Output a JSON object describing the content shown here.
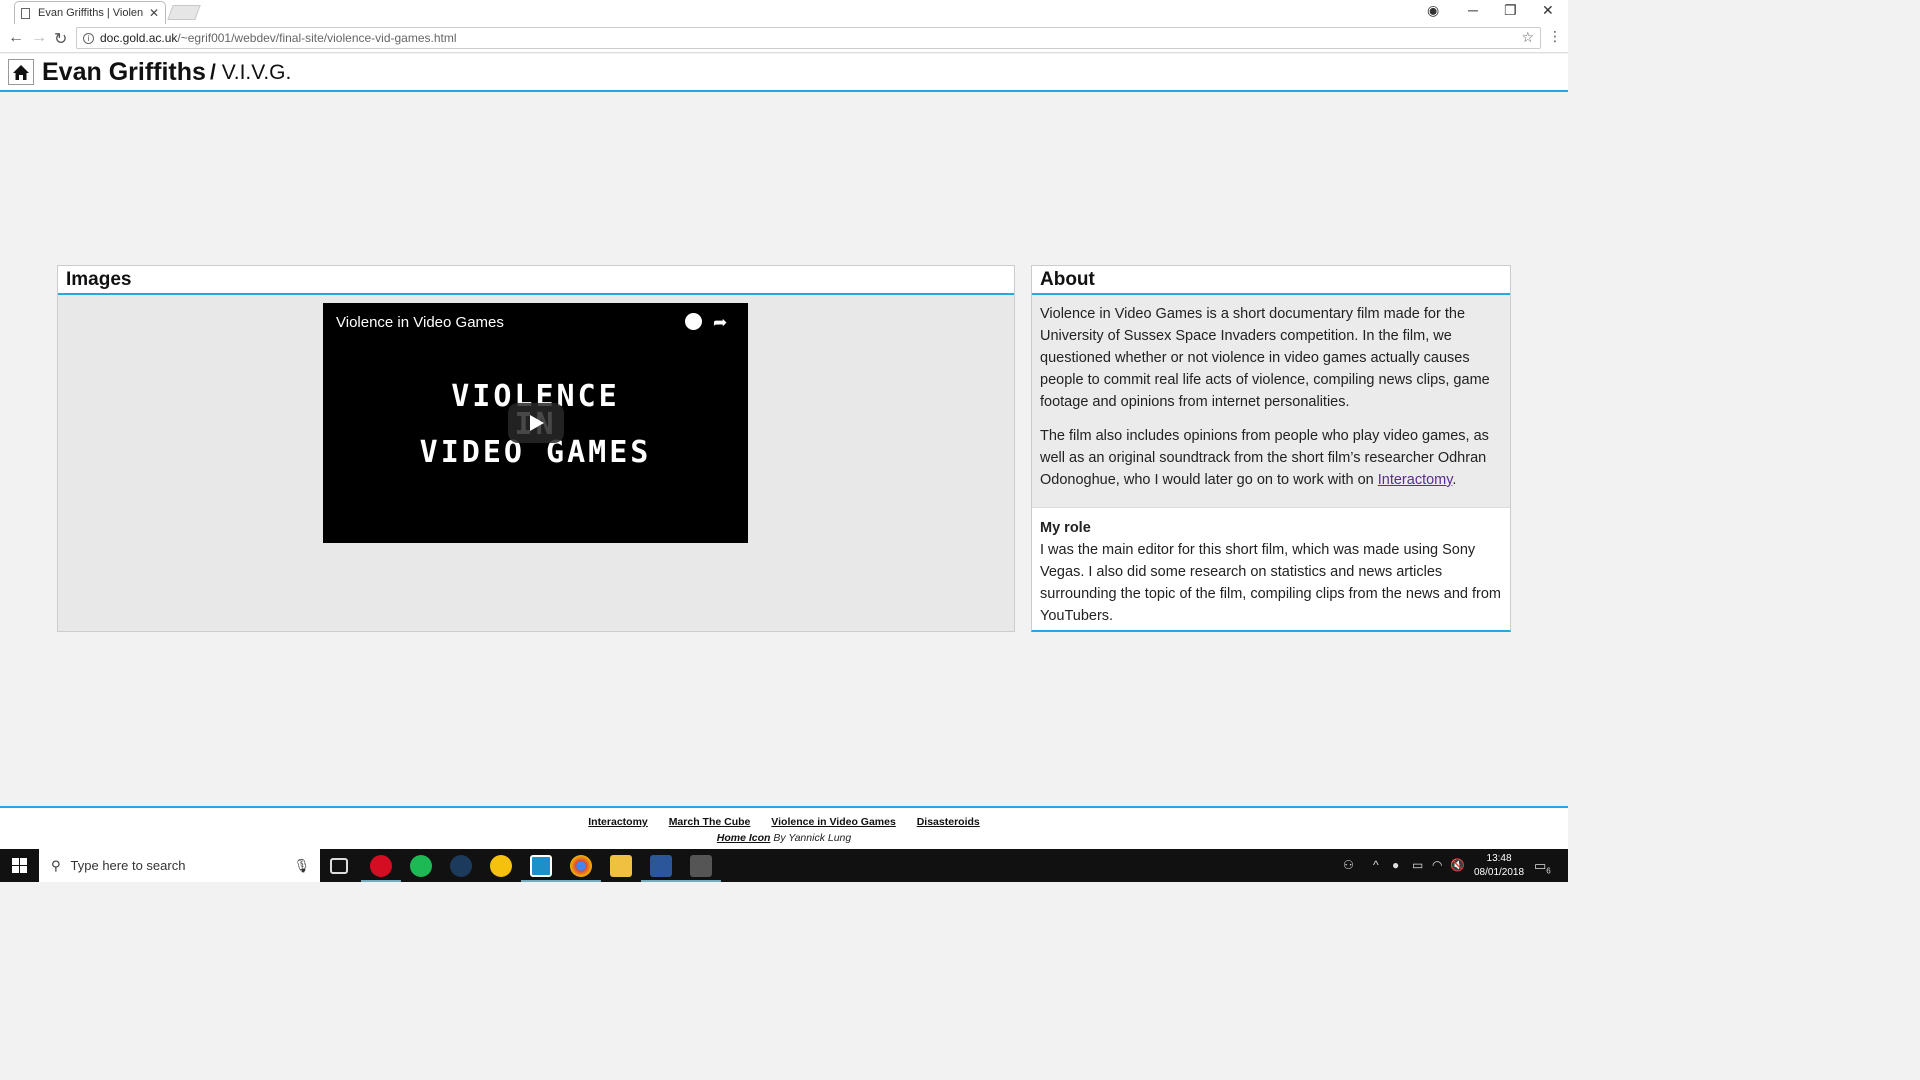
{
  "browser": {
    "tab_title": "Evan Griffiths | Violence i",
    "url_host": "doc.gold.ac.uk",
    "url_path": "/~egrif001/webdev/final-site/violence-vid-games.html"
  },
  "site": {
    "name": "Evan Griffiths",
    "separator": "/",
    "page": "V.I.V.G."
  },
  "images_panel": {
    "heading": "Images",
    "video_title": "Violence in Video Games",
    "video_art_line1": "VIOLENCE",
    "video_art_line2": "IN",
    "video_art_line3": "VIDEO GAMES"
  },
  "about_panel": {
    "heading": "About",
    "paragraph1": "Violence in Video Games is a short documentary film made for the University of Sussex Space Invaders competition. In the film, we questioned whether or not violence in video games actually causes people to commit real life acts of violence, compiling news clips, game footage and opinions from internet personalities.",
    "paragraph2_before": "The film also includes opinions from people who play video games, as well as an original soundtrack from the short film’s researcher Odhran Odonoghue, who I would later go on to work with on ",
    "paragraph2_link": "Interactomy",
    "paragraph2_after": ".",
    "role_title": "My role",
    "role_text": "I was the main editor for this short film, which was made using Sony Vegas. I also did some research on statistics and news articles surrounding the topic of the film, compiling clips from the news and from YouTubers."
  },
  "footer": {
    "links": [
      "Interactomy",
      "March The Cube",
      "Violence in Video Games",
      "Disasteroids"
    ],
    "credit_link": "Home Icon",
    "credit_text": " By Yannick Lung"
  },
  "taskbar": {
    "search_placeholder": "Type here to search",
    "time": "13:48",
    "date": "08/01/2018",
    "notification_count": "6"
  }
}
